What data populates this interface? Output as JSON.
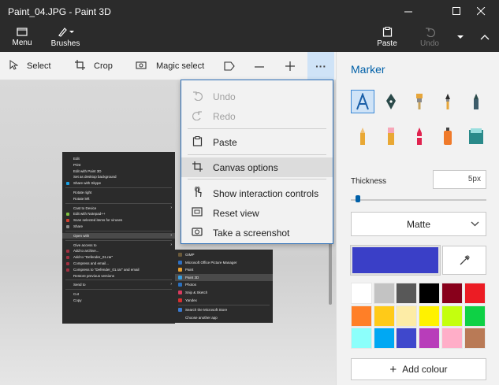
{
  "window": {
    "title": "Paint_04.JPG - Paint 3D"
  },
  "ribbon": {
    "menu_label": "Menu",
    "brushes_label": "Brushes",
    "paste_label": "Paste",
    "undo_label": "Undo"
  },
  "toolbar": {
    "select_label": "Select",
    "crop_label": "Crop",
    "magic_select_label": "Magic select"
  },
  "dropdown": {
    "items": [
      {
        "label": "Undo",
        "icon": "undo-icon",
        "enabled": false
      },
      {
        "label": "Redo",
        "icon": "redo-icon",
        "enabled": false
      },
      {
        "label": "Paste",
        "icon": "paste-icon",
        "enabled": true
      },
      {
        "label": "Canvas options",
        "icon": "canvas-icon",
        "enabled": true,
        "hover": true
      },
      {
        "label": "Show interaction controls",
        "icon": "touch-icon",
        "enabled": true
      },
      {
        "label": "Reset view",
        "icon": "reset-view-icon",
        "enabled": true
      },
      {
        "label": "Take a screenshot",
        "icon": "camera-icon",
        "enabled": true
      }
    ]
  },
  "canvas_image": {
    "context_menu": [
      "Edit",
      "Print",
      "Edit with Paint 3D",
      "Set as desktop background",
      "Share with Skype",
      "Rotate right",
      "Rotate left",
      "Cast to Device",
      "Edit with Notepad++",
      "Scan selected items for viruses",
      "Share",
      "Open with",
      "Give access to",
      "Add to archive...",
      "Add to \"Defender_01.rar\"",
      "Compress and email...",
      "Compress to \"Defender_01.rar\" and email",
      "Restore previous versions",
      "Send to",
      "Cut",
      "Copy"
    ],
    "submenu": [
      "GIMP",
      "Microsoft Office Picture Manager",
      "Paint",
      "Paint 3D",
      "Photos",
      "Snip & Sketch",
      "Yandex",
      "Search the Microsoft Store",
      "Choose another app"
    ]
  },
  "panel": {
    "title": "Marker",
    "thickness_label": "Thickness",
    "thickness_value": "5px",
    "finish_value": "Matte",
    "current_color": "#3a3fc7",
    "add_colour_label": "Add colour",
    "palette": [
      "#ffffff",
      "#c3c3c3",
      "#585858",
      "#000000",
      "#88001b",
      "#ec1c24",
      "#ff7f27",
      "#ffca18",
      "#fdeca6",
      "#fff200",
      "#c4ff0e",
      "#0ed145",
      "#8cfffb",
      "#00a8f3",
      "#3f48cc",
      "#b83dba",
      "#ffaec8",
      "#b97a56"
    ]
  }
}
